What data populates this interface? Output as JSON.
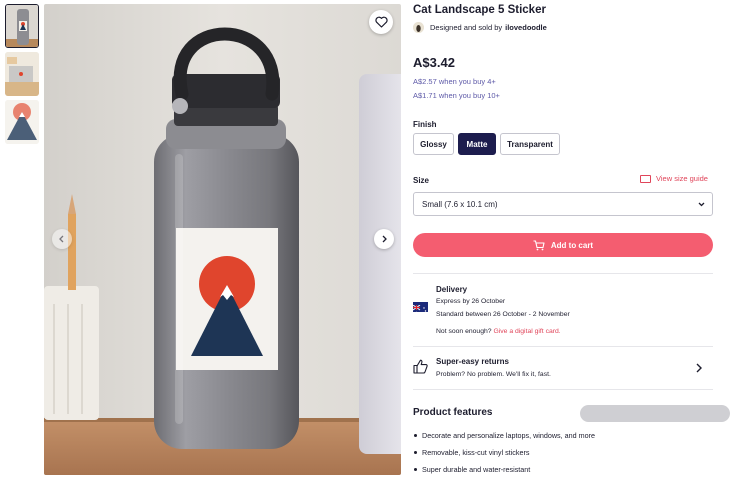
{
  "product": {
    "title": "Cat Landscape 5 Sticker",
    "byline_prefix": "Designed and sold by",
    "artist": "ilovedoodle",
    "price": "A$3.42",
    "bulk_pricing": [
      "A$2.57 when you buy 4+",
      "A$1.71 when you buy 10+"
    ]
  },
  "finish": {
    "label": "Finish",
    "options": [
      "Glossy",
      "Matte",
      "Transparent"
    ],
    "selected": "Matte"
  },
  "size": {
    "label": "Size",
    "guide_link": "View size guide",
    "selected": "Small (7.6 x 10.1 cm)"
  },
  "cart": {
    "label": "Add to cart"
  },
  "delivery": {
    "title": "Delivery",
    "express": "Express by 26 October",
    "standard": "Standard between 26 October - 2 November",
    "not_soon_prefix": "Not soon enough?",
    "gift_link": "Give a digital gift card."
  },
  "returns": {
    "title": "Super-easy returns",
    "subtitle": "Problem? No problem. We'll fix it, fast."
  },
  "features": {
    "title": "Product features",
    "items": [
      "Decorate and personalize laptops, windows, and more",
      "Removable, kiss-cut vinyl stickers",
      "Super durable and water-resistant"
    ]
  },
  "colors": {
    "accent": "#f45d70",
    "selected_option": "#1d1d4e",
    "link": "#5e5aa8",
    "sun": "#e0452d",
    "mountain": "#1e3555"
  },
  "icons": [
    "heart-icon",
    "chevron-left-icon",
    "chevron-right-icon",
    "cart-icon",
    "ruler-icon",
    "chevron-down-icon",
    "australia-flag-icon",
    "thumbs-up-icon",
    "chevron-right-icon"
  ]
}
